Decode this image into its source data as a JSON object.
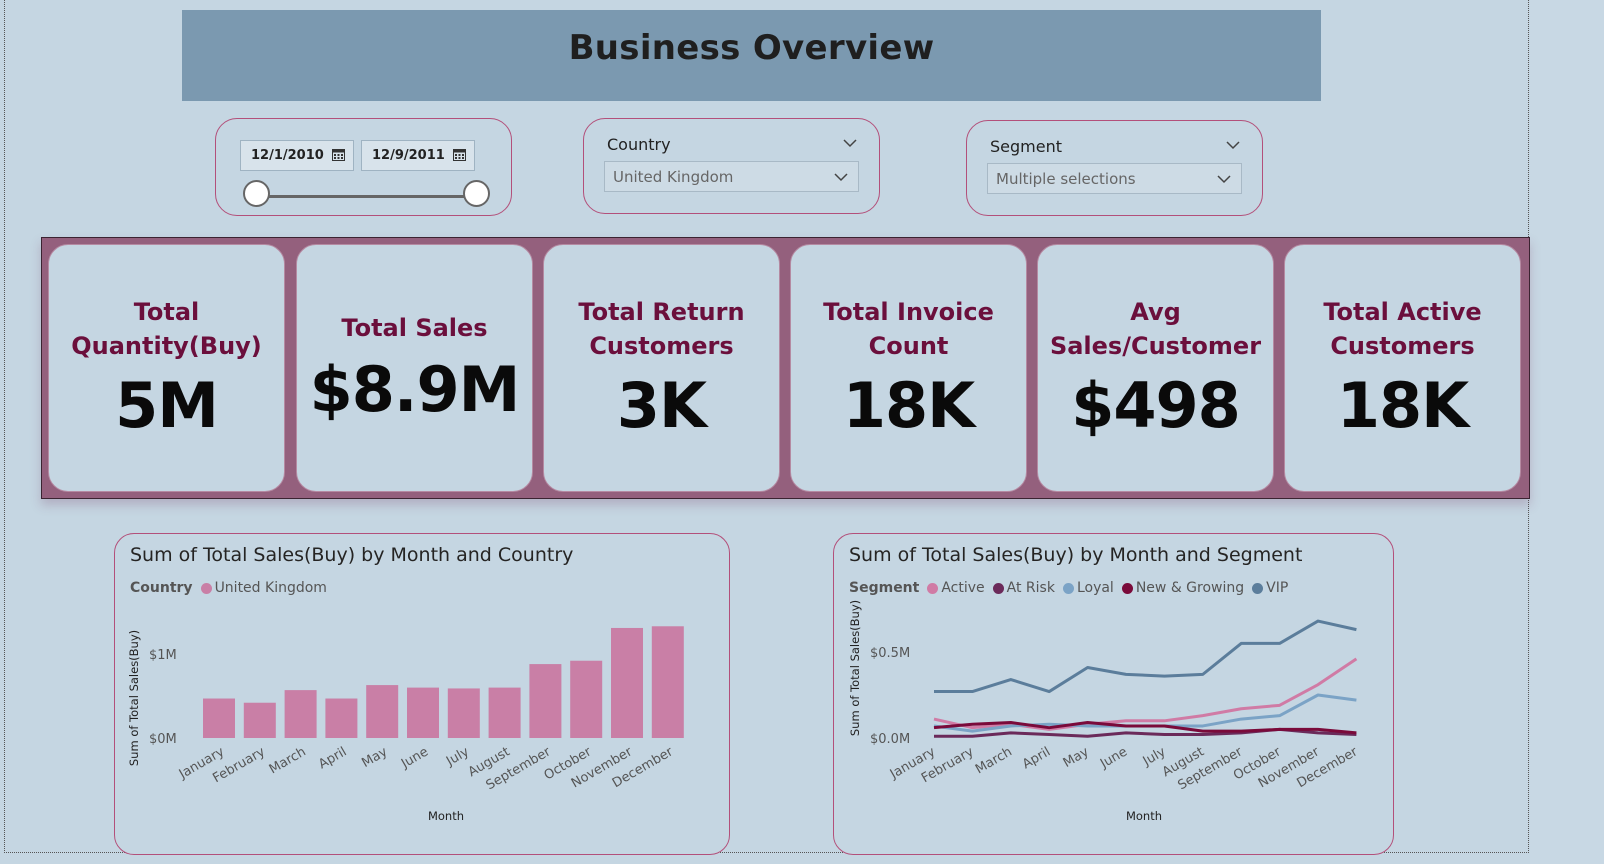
{
  "header": {
    "title": "Business Overview"
  },
  "date_filter": {
    "start": "12/1/2010",
    "end": "12/9/2011"
  },
  "country_filter": {
    "label": "Country",
    "selected": "United Kingdom"
  },
  "segment_filter": {
    "label": "Segment",
    "selected": "Multiple selections"
  },
  "kpis": [
    {
      "label": "Total Quantity(Buy)",
      "value": "5M"
    },
    {
      "label": "Total Sales",
      "value": "$8.9M"
    },
    {
      "label": "Total Return Customers",
      "value": "3K"
    },
    {
      "label": "Total Invoice Count",
      "value": "18K"
    },
    {
      "label": "Avg Sales/Customer",
      "value": "$498"
    },
    {
      "label": "Total Active Customers",
      "value": "18K"
    }
  ],
  "colors": {
    "accent": "#b3507a",
    "kpi_band": "#94607d",
    "kpi_label": "#6b0f3c",
    "active": "#d07ba5",
    "at_risk": "#6b2a5a",
    "loyal": "#7ba3c6",
    "new_growing": "#7a0a3a",
    "vip": "#5b7d9b"
  },
  "chart_data": [
    {
      "type": "bar",
      "title": "Sum of Total Sales(Buy) by Month and Country",
      "legend_title": "Country",
      "xlabel": "Month",
      "ylabel": "Sum of Total Sales(Buy)",
      "yticks": [
        "$0M",
        "$1M"
      ],
      "ylim": [
        0,
        1500000
      ],
      "categories": [
        "January",
        "February",
        "March",
        "April",
        "May",
        "June",
        "July",
        "August",
        "September",
        "October",
        "November",
        "December"
      ],
      "series": [
        {
          "name": "United Kingdom",
          "color": "#c97fa6",
          "values": [
            470000,
            420000,
            570000,
            470000,
            630000,
            600000,
            590000,
            600000,
            880000,
            920000,
            1310000,
            1330000
          ]
        }
      ],
      "grid": false,
      "legend_position": "top-left"
    },
    {
      "type": "line",
      "title": "Sum of Total Sales(Buy) by Month and Segment",
      "legend_title": "Segment",
      "xlabel": "Month",
      "ylabel": "Sum of Total Sales(Buy)",
      "yticks": [
        "$0.0M",
        "$0.5M"
      ],
      "ylim": [
        0,
        0.8
      ],
      "categories": [
        "January",
        "February",
        "March",
        "April",
        "May",
        "June",
        "July",
        "August",
        "September",
        "October",
        "November",
        "December"
      ],
      "series": [
        {
          "name": "Active",
          "color": "#d07ba5",
          "values": [
            0.11,
            0.06,
            0.08,
            0.05,
            0.08,
            0.1,
            0.1,
            0.13,
            0.17,
            0.19,
            0.31,
            0.46
          ]
        },
        {
          "name": "At Risk",
          "color": "#6b2a5a",
          "values": [
            0.01,
            0.01,
            0.03,
            0.02,
            0.01,
            0.03,
            0.02,
            0.02,
            0.03,
            0.05,
            0.03,
            0.02
          ]
        },
        {
          "name": "Loyal",
          "color": "#7ba3c6",
          "values": [
            0.07,
            0.04,
            0.07,
            0.08,
            0.07,
            0.07,
            0.07,
            0.07,
            0.11,
            0.13,
            0.25,
            0.22
          ]
        },
        {
          "name": "New & Growing",
          "color": "#7a0a3a",
          "values": [
            0.06,
            0.08,
            0.09,
            0.06,
            0.09,
            0.07,
            0.07,
            0.04,
            0.04,
            0.05,
            0.05,
            0.03
          ]
        },
        {
          "name": "VIP",
          "color": "#5b7d9b",
          "values": [
            0.27,
            0.27,
            0.34,
            0.27,
            0.41,
            0.37,
            0.36,
            0.37,
            0.55,
            0.55,
            0.68,
            0.63
          ]
        }
      ],
      "grid": false,
      "legend_position": "top-left"
    }
  ]
}
